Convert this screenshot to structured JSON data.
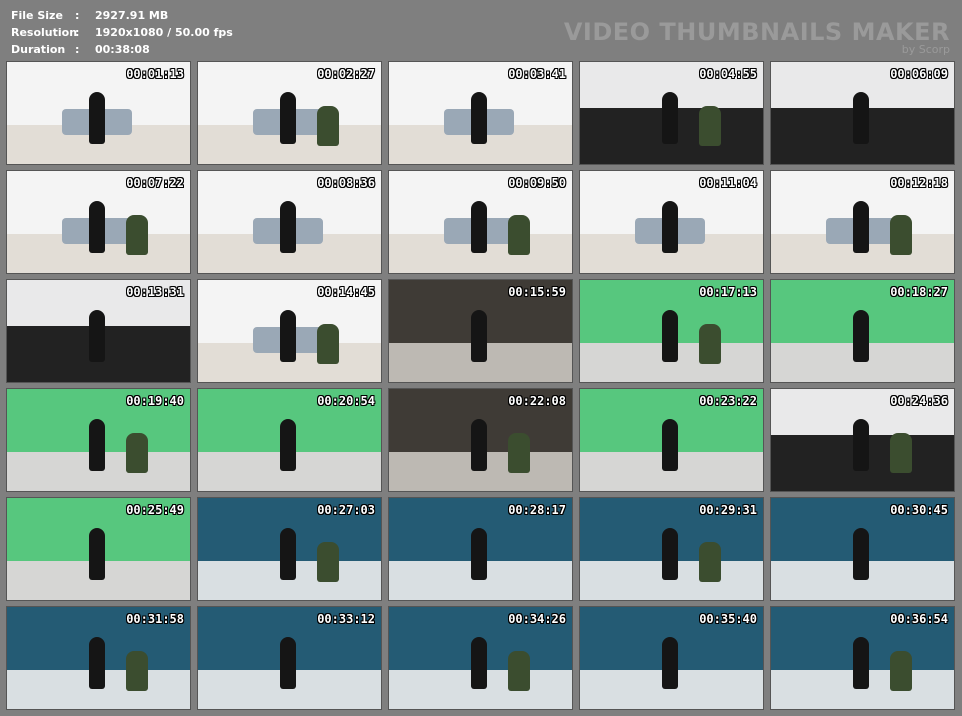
{
  "info": {
    "file_size_label": "File Size",
    "file_size_value": "2927.91 MB",
    "resolution_label": "Resolution",
    "resolution_value": "1920x1080 / 50.00 fps",
    "duration_label": "Duration",
    "duration_value": "00:38:08",
    "separator": ":"
  },
  "brand": {
    "title": "VIDEO THUMBNAILS MAKER",
    "byline": "by Scorp"
  },
  "thumbnails": [
    {
      "time": "00:01:13",
      "scene": "white"
    },
    {
      "time": "00:02:27",
      "scene": "white"
    },
    {
      "time": "00:03:41",
      "scene": "white"
    },
    {
      "time": "00:04:55",
      "scene": "close"
    },
    {
      "time": "00:06:09",
      "scene": "close"
    },
    {
      "time": "00:07:22",
      "scene": "white"
    },
    {
      "time": "00:08:36",
      "scene": "white"
    },
    {
      "time": "00:09:50",
      "scene": "white"
    },
    {
      "time": "00:11:04",
      "scene": "white"
    },
    {
      "time": "00:12:18",
      "scene": "white"
    },
    {
      "time": "00:13:31",
      "scene": "close"
    },
    {
      "time": "00:14:45",
      "scene": "white"
    },
    {
      "time": "00:15:59",
      "scene": "dark"
    },
    {
      "time": "00:17:13",
      "scene": "green"
    },
    {
      "time": "00:18:27",
      "scene": "green"
    },
    {
      "time": "00:19:40",
      "scene": "green"
    },
    {
      "time": "00:20:54",
      "scene": "green"
    },
    {
      "time": "00:22:08",
      "scene": "dark"
    },
    {
      "time": "00:23:22",
      "scene": "green"
    },
    {
      "time": "00:24:36",
      "scene": "close"
    },
    {
      "time": "00:25:49",
      "scene": "green"
    },
    {
      "time": "00:27:03",
      "scene": "teal"
    },
    {
      "time": "00:28:17",
      "scene": "teal"
    },
    {
      "time": "00:29:31",
      "scene": "teal"
    },
    {
      "time": "00:30:45",
      "scene": "teal"
    },
    {
      "time": "00:31:58",
      "scene": "teal"
    },
    {
      "time": "00:33:12",
      "scene": "teal"
    },
    {
      "time": "00:34:26",
      "scene": "teal"
    },
    {
      "time": "00:35:40",
      "scene": "teal"
    },
    {
      "time": "00:36:54",
      "scene": "teal"
    }
  ]
}
